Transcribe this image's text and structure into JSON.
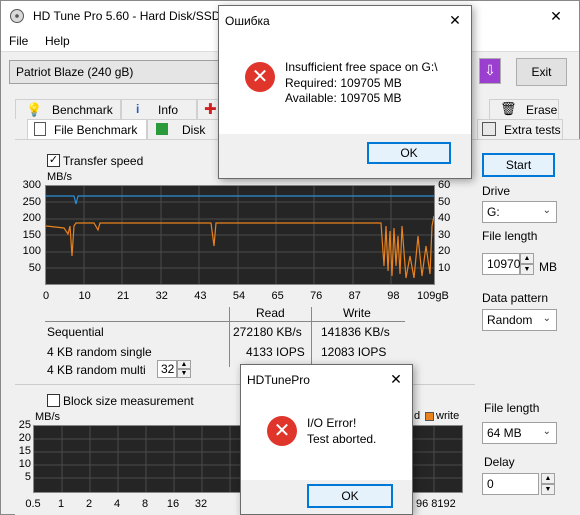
{
  "main_window": {
    "title": "HD Tune Pro 5.60 - Hard Disk/SSD U",
    "menu": [
      "File",
      "Help"
    ],
    "drive": "Patriot Blaze (240 gB)",
    "exit_label": "Exit"
  },
  "tabs_top": [
    "Benchmark",
    "Info",
    "Erase"
  ],
  "tabs_bottom": [
    "File Benchmark",
    "Disk mo",
    "Extra tests"
  ],
  "file_benchmark": {
    "transfer_speed_label": "Transfer speed",
    "y_unit": "MB/s",
    "y_ticks": [
      "300",
      "250",
      "200",
      "150",
      "100",
      "50"
    ],
    "y_right_ticks": [
      "60",
      "50",
      "40",
      "30",
      "20",
      "10"
    ],
    "x_ticks": [
      "0",
      "10",
      "21",
      "32",
      "43",
      "54",
      "65",
      "76",
      "87",
      "98",
      "109gB"
    ],
    "read_header": "Read",
    "write_header": "Write",
    "rows": [
      {
        "label": "Sequential",
        "read": "272180 KB/s",
        "write": "141836 KB/s"
      },
      {
        "label": "4 KB random single",
        "read": "4133 IOPS",
        "write": "12083 IOPS"
      },
      {
        "label": "4 KB random multi",
        "read": "",
        "write": ""
      }
    ],
    "multi_value": "32",
    "block_size_label": "Block size measurement",
    "block_y_unit": "MB/s",
    "block_y_ticks": [
      "25",
      "20",
      "15",
      "10",
      "5"
    ],
    "block_x_ticks": [
      "0.5",
      "1",
      "2",
      "4",
      "8",
      "16",
      "32"
    ],
    "block_x_tail": "96 8192",
    "legend_read": "d",
    "legend_write": "write",
    "start_label": "Start",
    "drive_label": "Drive",
    "drive_value": "G:",
    "file_length_label": "File length",
    "file_length_value": "109704",
    "file_length_unit": "MB",
    "data_pattern_label": "Data pattern",
    "data_pattern_value": "Random",
    "file_length2_label": "File length",
    "file_length2_value": "64 MB",
    "delay_label": "Delay",
    "delay_value": "0"
  },
  "dialog1": {
    "title": "Ошибка",
    "line1": "Insufficient free space on G:\\",
    "line2": "Required: 109705 MB",
    "line3": "Available: 109705 MB",
    "ok": "OK"
  },
  "dialog2": {
    "title": "HDTunePro",
    "line1": "I/O Error!",
    "line2": "Test aborted.",
    "ok": "OK"
  },
  "colors": {
    "read": "#2a8fd6",
    "write": "#e8821e",
    "error": "#e0352b",
    "focus": "#0078d7"
  }
}
